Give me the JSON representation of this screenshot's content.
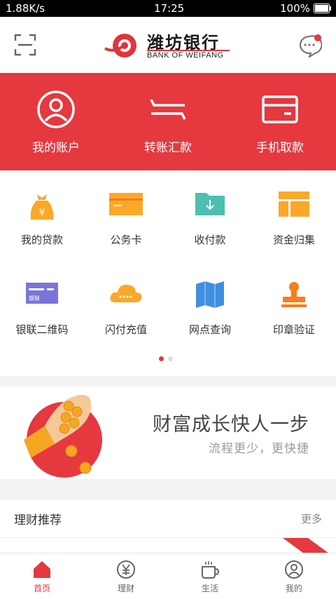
{
  "status_bar": {
    "speed": "1.88K/s",
    "time": "17:25",
    "battery": "100%"
  },
  "header": {
    "logo_cn": "潍坊银行",
    "logo_en": "BANK OF WEIFANG"
  },
  "top_actions": [
    {
      "label": "我的账户",
      "icon": "user-circle-icon"
    },
    {
      "label": "转账汇款",
      "icon": "transfer-arrows-icon"
    },
    {
      "label": "手机取款",
      "icon": "card-icon"
    }
  ],
  "services": [
    {
      "label": "我的贷款",
      "icon": "money-bag-icon"
    },
    {
      "label": "公务卡",
      "icon": "official-card-icon"
    },
    {
      "label": "收付款",
      "icon": "folder-download-icon"
    },
    {
      "label": "资金归集",
      "icon": "fund-collect-icon"
    },
    {
      "label": "银联二维码",
      "icon": "unionpay-card-icon",
      "badge": "银联"
    },
    {
      "label": "闪付充值",
      "icon": "cloud-pay-icon"
    },
    {
      "label": "网点查询",
      "icon": "map-icon"
    },
    {
      "label": "印章验证",
      "icon": "stamp-icon"
    }
  ],
  "pager": {
    "active": 0,
    "count": 2
  },
  "banner": {
    "title": "财富成长快人一步",
    "subtitle": "流程更少，更快捷"
  },
  "recommend": {
    "title": "理财推荐",
    "more": "更多"
  },
  "tabbar": [
    {
      "label": "首页",
      "icon": "home-icon",
      "active": true
    },
    {
      "label": "理财",
      "icon": "yen-circle-icon",
      "active": false
    },
    {
      "label": "生活",
      "icon": "coffee-cup-icon",
      "active": false
    },
    {
      "label": "我的",
      "icon": "profile-icon",
      "active": false
    }
  ],
  "colors": {
    "brand_red": "#e5383f",
    "orange": "#fba82a",
    "teal": "#4dbfb0",
    "blue": "#3f8fe0",
    "purple": "#7b74d9"
  }
}
